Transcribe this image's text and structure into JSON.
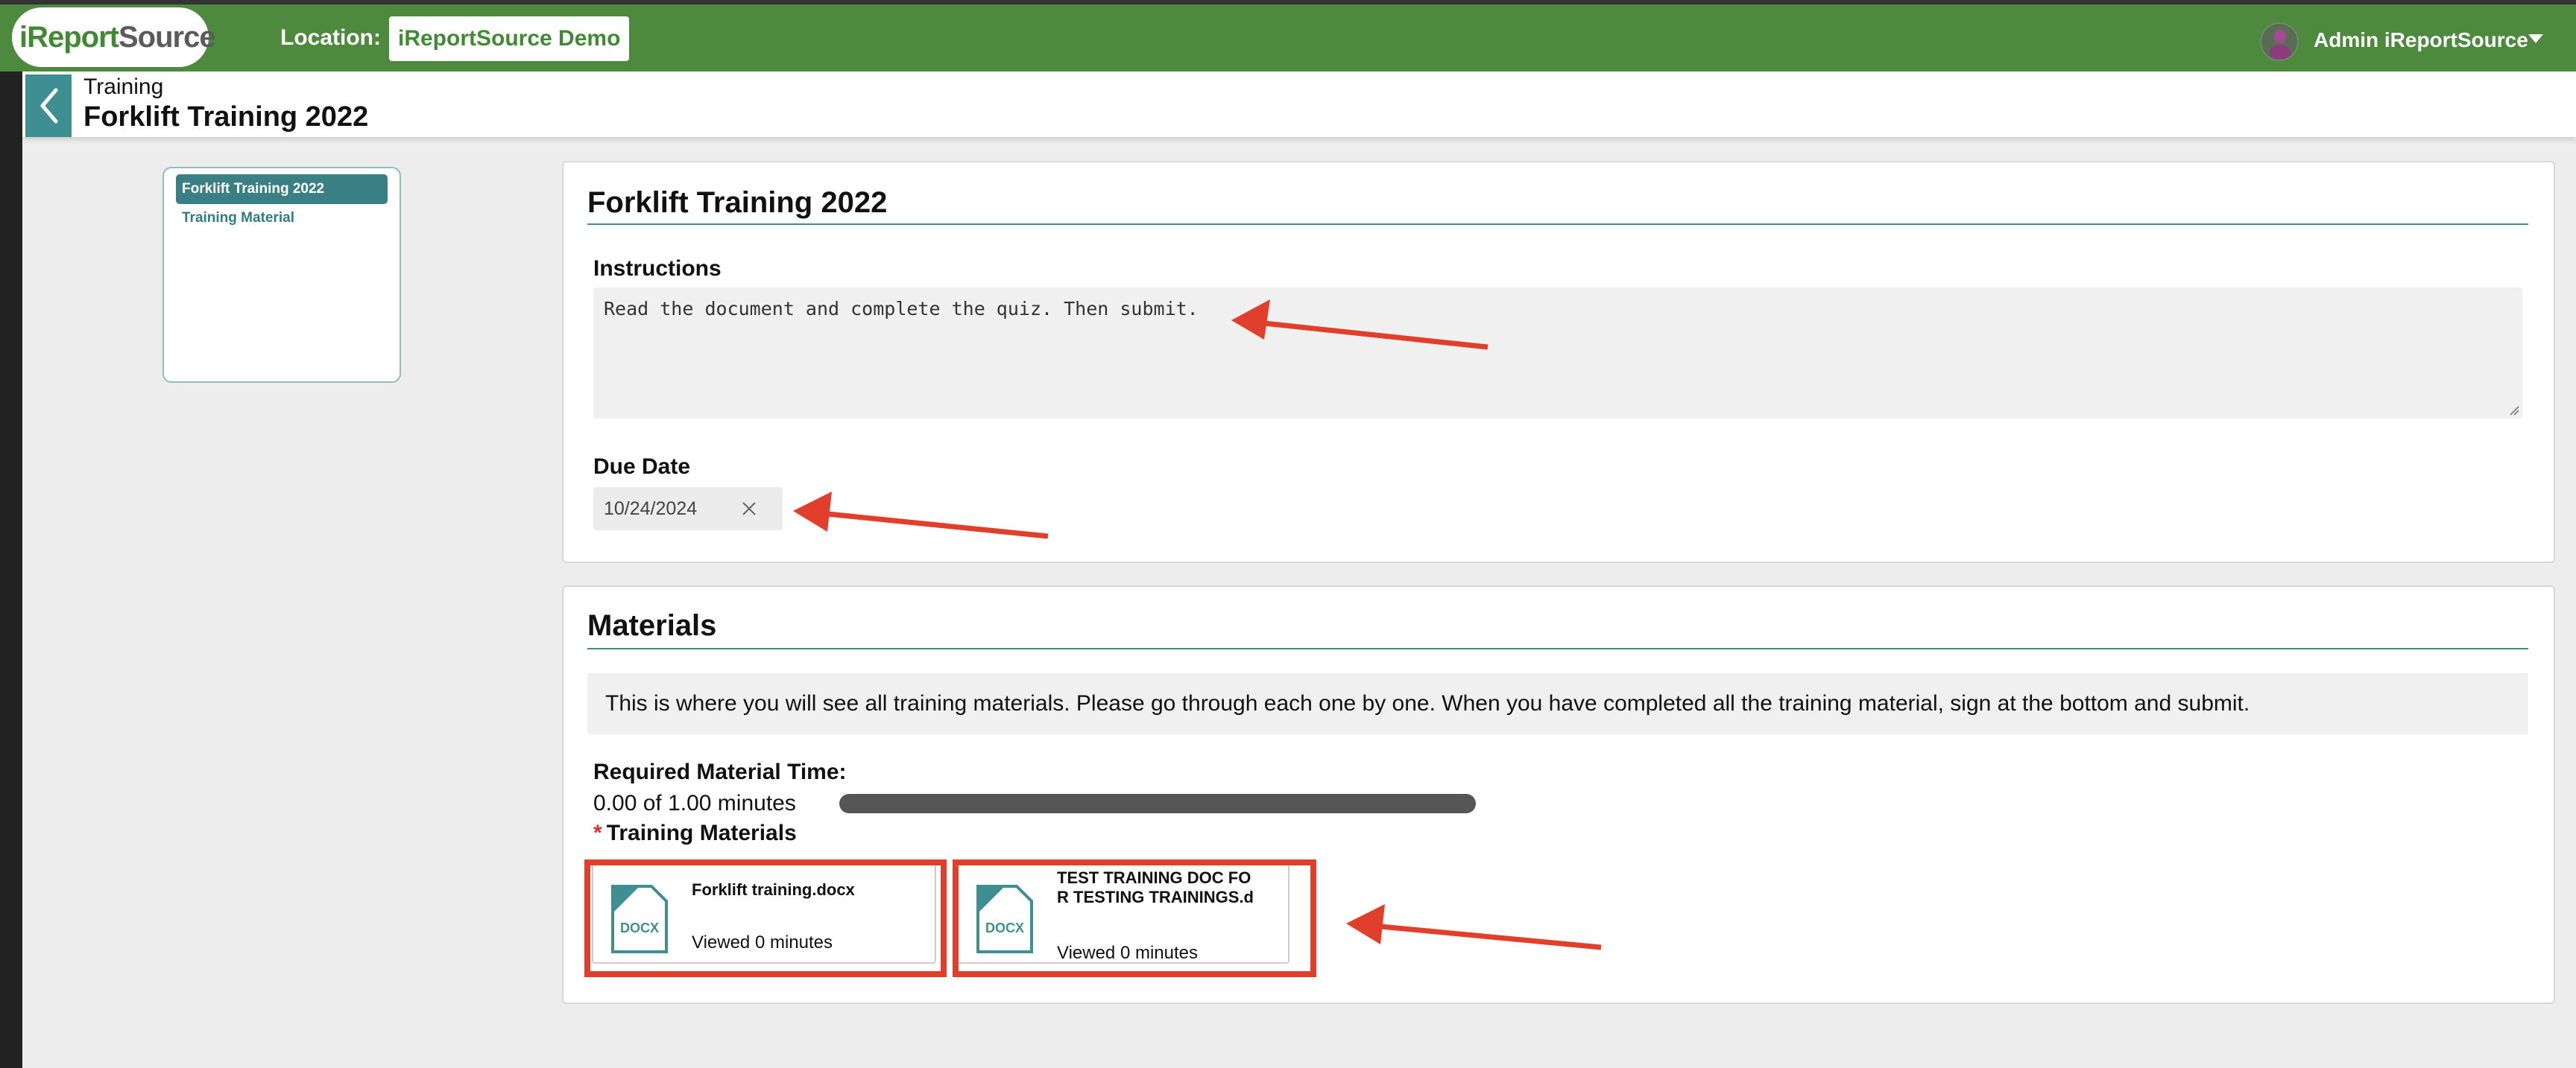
{
  "header": {
    "logo": "iReportSource",
    "location_label": "Location:",
    "location_value": "iReportSource Demo",
    "user_name": "Admin iReportSource"
  },
  "subheader": {
    "breadcrumb": "Training",
    "title": "Forklift Training 2022"
  },
  "nav": {
    "items": [
      {
        "label": "Forklift Training 2022",
        "active": true
      },
      {
        "label": "Training Material",
        "active": false
      }
    ]
  },
  "details": {
    "title": "Forklift Training 2022",
    "instructions_label": "Instructions",
    "instructions_value": "Read the document and complete the quiz. Then submit.",
    "due_date_label": "Due Date",
    "due_date_value": "10/24/2024"
  },
  "materials": {
    "title": "Materials",
    "info": "This is where you will see all training materials. Please go through each one by one. When you have completed all the training material, sign at the bottom and submit.",
    "required_time_label": "Required Material Time:",
    "required_time_value": "0.00 of 1.00 minutes",
    "progress_fraction": 0.0,
    "required_marker": "*",
    "training_materials_label": "Training Materials",
    "files": [
      {
        "type": "DOCX",
        "name": "Forklift training.docx",
        "viewed": "Viewed 0 minutes"
      },
      {
        "type": "DOCX",
        "name_line1": "TEST TRAINING DOC FO",
        "name_line2": "R TESTING TRAININGS.d",
        "viewed": "Viewed 0 minutes"
      }
    ]
  },
  "colors": {
    "header_green": "#4d8a3e",
    "teal": "#3f8f92",
    "annotation_red": "#e23e2c"
  }
}
